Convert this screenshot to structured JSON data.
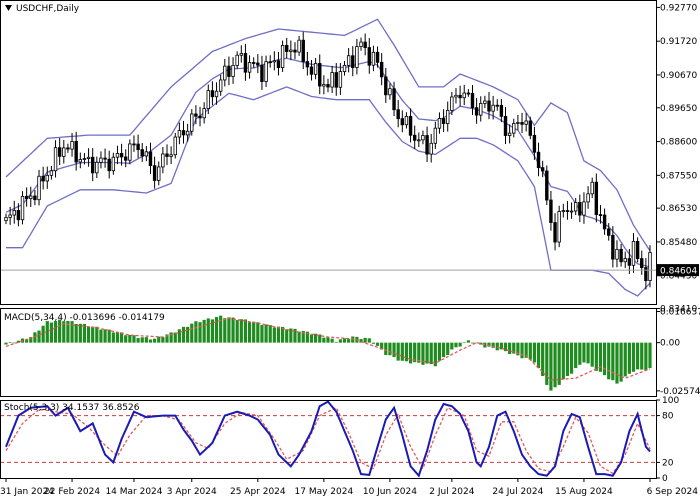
{
  "chart_data": {
    "type": "candlestick",
    "symbol_label": "USDCHF,Daily",
    "current_price_label": "0.84604",
    "colors": {
      "bollinger": "#6e6ec8",
      "candle": "#000000",
      "macd_hist": "#1f8c1f",
      "macd_signal": "#e05a5a",
      "stoch_main": "#1a1ab4",
      "stoch_signal": "#e05a5a",
      "level_line": "#c83c3c",
      "price_line": "#a0a0a0",
      "price_tag_bg": "#000000",
      "price_tag_fg": "#ffffff"
    },
    "main": {
      "ylim": [
        0.8355,
        0.93
      ],
      "y_ticks": [
        "0.92770",
        "0.91720",
        "0.90670",
        "0.89650",
        "0.88600",
        "0.87550",
        "0.86530",
        "0.85480",
        "0.84430",
        "0.83410"
      ],
      "y_tick_values": [
        0.9277,
        0.9172,
        0.9067,
        0.8965,
        0.886,
        0.8755,
        0.8653,
        0.8548,
        0.8443,
        0.8341
      ],
      "current_price": 0.84604,
      "close_anchors": [
        [
          0,
          0.861
        ],
        [
          8,
          0.872
        ],
        [
          14,
          0.885
        ],
        [
          20,
          0.879
        ],
        [
          26,
          0.88
        ],
        [
          32,
          0.885
        ],
        [
          36,
          0.876
        ],
        [
          42,
          0.888
        ],
        [
          47,
          0.895
        ],
        [
          52,
          0.905
        ],
        [
          56,
          0.912
        ],
        [
          62,
          0.908
        ],
        [
          66,
          0.912
        ],
        [
          70,
          0.916
        ],
        [
          74,
          0.908
        ],
        [
          78,
          0.903
        ],
        [
          82,
          0.909
        ],
        [
          86,
          0.916
        ],
        [
          90,
          0.91
        ],
        [
          94,
          0.896
        ],
        [
          98,
          0.889
        ],
        [
          102,
          0.884
        ],
        [
          106,
          0.894
        ],
        [
          110,
          0.902
        ],
        [
          114,
          0.896
        ],
        [
          118,
          0.898
        ],
        [
          122,
          0.888
        ],
        [
          125,
          0.894
        ],
        [
          129,
          0.88
        ],
        [
          131,
          0.868
        ],
        [
          133,
          0.856
        ],
        [
          135,
          0.866
        ],
        [
          138,
          0.864
        ],
        [
          142,
          0.871
        ],
        [
          145,
          0.858
        ],
        [
          147,
          0.853
        ],
        [
          149,
          0.848
        ],
        [
          152,
          0.852
        ],
        [
          155,
          0.845
        ],
        [
          156,
          0.848
        ]
      ],
      "bb_upper_anchors": [
        [
          0,
          0.875
        ],
        [
          10,
          0.887
        ],
        [
          20,
          0.888
        ],
        [
          30,
          0.888
        ],
        [
          40,
          0.903
        ],
        [
          50,
          0.914
        ],
        [
          58,
          0.918
        ],
        [
          66,
          0.921
        ],
        [
          74,
          0.92
        ],
        [
          82,
          0.919
        ],
        [
          90,
          0.924
        ],
        [
          94,
          0.916
        ],
        [
          100,
          0.903
        ],
        [
          106,
          0.903
        ],
        [
          110,
          0.907
        ],
        [
          118,
          0.903
        ],
        [
          124,
          0.899
        ],
        [
          128,
          0.891
        ],
        [
          132,
          0.898
        ],
        [
          136,
          0.895
        ],
        [
          140,
          0.88
        ],
        [
          144,
          0.877
        ],
        [
          148,
          0.871
        ],
        [
          152,
          0.86
        ],
        [
          156,
          0.852
        ]
      ],
      "bb_lower_anchors": [
        [
          0,
          0.853
        ],
        [
          4,
          0.853
        ],
        [
          10,
          0.866
        ],
        [
          18,
          0.871
        ],
        [
          26,
          0.871
        ],
        [
          34,
          0.87
        ],
        [
          40,
          0.873
        ],
        [
          46,
          0.893
        ],
        [
          54,
          0.901
        ],
        [
          60,
          0.899
        ],
        [
          68,
          0.903
        ],
        [
          74,
          0.9
        ],
        [
          80,
          0.899
        ],
        [
          88,
          0.899
        ],
        [
          92,
          0.892
        ],
        [
          96,
          0.886
        ],
        [
          100,
          0.883
        ],
        [
          104,
          0.882
        ],
        [
          110,
          0.887
        ],
        [
          114,
          0.887
        ],
        [
          118,
          0.885
        ],
        [
          124,
          0.88
        ],
        [
          128,
          0.872
        ],
        [
          132,
          0.846
        ],
        [
          136,
          0.846
        ],
        [
          142,
          0.846
        ],
        [
          146,
          0.845
        ],
        [
          150,
          0.84
        ],
        [
          153,
          0.838
        ],
        [
          156,
          0.842
        ]
      ]
    },
    "macd": {
      "label": "MACD(5,34,4) -0.013696 -0.014179",
      "ylim": [
        -0.0285,
        0.0185
      ],
      "y_ticks": [
        "0.016637",
        "0.00",
        "-0.025749"
      ],
      "y_tick_values": [
        0.016637,
        0.0,
        -0.025749
      ],
      "hist_anchors": [
        [
          0,
          -0.001
        ],
        [
          6,
          0.003
        ],
        [
          10,
          0.011
        ],
        [
          14,
          0.012
        ],
        [
          20,
          0.009
        ],
        [
          26,
          0.006
        ],
        [
          32,
          0.003
        ],
        [
          36,
          0.002
        ],
        [
          40,
          0.005
        ],
        [
          46,
          0.011
        ],
        [
          52,
          0.014
        ],
        [
          58,
          0.012
        ],
        [
          64,
          0.009
        ],
        [
          70,
          0.007
        ],
        [
          76,
          0.004
        ],
        [
          80,
          0.001
        ],
        [
          84,
          0.003
        ],
        [
          88,
          0.002
        ],
        [
          92,
          -0.006
        ],
        [
          96,
          -0.01
        ],
        [
          100,
          -0.011
        ],
        [
          104,
          -0.012
        ],
        [
          108,
          -0.004
        ],
        [
          112,
          0.001
        ],
        [
          116,
          -0.002
        ],
        [
          120,
          -0.004
        ],
        [
          124,
          -0.007
        ],
        [
          128,
          -0.01
        ],
        [
          132,
          -0.026
        ],
        [
          136,
          -0.018
        ],
        [
          140,
          -0.01
        ],
        [
          144,
          -0.016
        ],
        [
          148,
          -0.022
        ],
        [
          152,
          -0.015
        ],
        [
          156,
          -0.014
        ]
      ],
      "signal_anchors": [
        [
          0,
          -0.002
        ],
        [
          8,
          0.004
        ],
        [
          14,
          0.01
        ],
        [
          22,
          0.008
        ],
        [
          30,
          0.004
        ],
        [
          38,
          0.003
        ],
        [
          46,
          0.008
        ],
        [
          54,
          0.013
        ],
        [
          62,
          0.01
        ],
        [
          70,
          0.006
        ],
        [
          78,
          0.003
        ],
        [
          84,
          0.002
        ],
        [
          92,
          -0.004
        ],
        [
          98,
          -0.009
        ],
        [
          104,
          -0.011
        ],
        [
          110,
          -0.004
        ],
        [
          114,
          0.0
        ],
        [
          120,
          -0.003
        ],
        [
          126,
          -0.007
        ],
        [
          132,
          -0.02
        ],
        [
          138,
          -0.019
        ],
        [
          144,
          -0.013
        ],
        [
          150,
          -0.019
        ],
        [
          156,
          -0.014
        ]
      ]
    },
    "stoch": {
      "label": "Stoch(5,3,3) 34.1537 36.8526",
      "ylim": [
        0,
        100
      ],
      "levels": [
        80,
        20
      ],
      "y_ticks": [
        "100",
        "80",
        "20",
        "0"
      ],
      "y_tick_values": [
        100,
        80,
        20,
        0
      ],
      "main_anchors": [
        [
          0,
          40
        ],
        [
          3,
          80
        ],
        [
          6,
          90
        ],
        [
          10,
          92
        ],
        [
          12,
          80
        ],
        [
          15,
          90
        ],
        [
          18,
          60
        ],
        [
          21,
          70
        ],
        [
          24,
          30
        ],
        [
          26,
          20
        ],
        [
          28,
          50
        ],
        [
          31,
          85
        ],
        [
          34,
          78
        ],
        [
          38,
          80
        ],
        [
          41,
          80
        ],
        [
          43,
          62
        ],
        [
          45,
          48
        ],
        [
          47,
          30
        ],
        [
          50,
          45
        ],
        [
          53,
          80
        ],
        [
          56,
          85
        ],
        [
          59,
          80
        ],
        [
          61,
          75
        ],
        [
          64,
          55
        ],
        [
          66,
          30
        ],
        [
          69,
          15
        ],
        [
          71,
          30
        ],
        [
          74,
          60
        ],
        [
          76,
          92
        ],
        [
          78,
          98
        ],
        [
          80,
          85
        ],
        [
          82,
          60
        ],
        [
          84,
          35
        ],
        [
          86,
          5
        ],
        [
          88,
          4
        ],
        [
          90,
          40
        ],
        [
          92,
          75
        ],
        [
          94,
          90
        ],
        [
          96,
          55
        ],
        [
          98,
          15
        ],
        [
          100,
          3
        ],
        [
          102,
          35
        ],
        [
          104,
          75
        ],
        [
          106,
          95
        ],
        [
          108,
          92
        ],
        [
          110,
          82
        ],
        [
          112,
          60
        ],
        [
          114,
          20
        ],
        [
          115,
          15
        ],
        [
          117,
          40
        ],
        [
          119,
          80
        ],
        [
          121,
          85
        ],
        [
          123,
          60
        ],
        [
          125,
          30
        ],
        [
          127,
          15
        ],
        [
          129,
          5
        ],
        [
          131,
          3
        ],
        [
          133,
          15
        ],
        [
          135,
          60
        ],
        [
          137,
          82
        ],
        [
          139,
          78
        ],
        [
          141,
          40
        ],
        [
          143,
          5
        ],
        [
          145,
          5
        ],
        [
          147,
          3
        ],
        [
          149,
          20
        ],
        [
          151,
          60
        ],
        [
          153,
          82
        ],
        [
          155,
          40
        ],
        [
          156,
          34
        ]
      ],
      "signal_anchors": [
        [
          0,
          35
        ],
        [
          4,
          70
        ],
        [
          8,
          88
        ],
        [
          12,
          85
        ],
        [
          16,
          82
        ],
        [
          20,
          65
        ],
        [
          24,
          42
        ],
        [
          27,
          28
        ],
        [
          30,
          55
        ],
        [
          34,
          80
        ],
        [
          38,
          80
        ],
        [
          42,
          74
        ],
        [
          46,
          45
        ],
        [
          49,
          38
        ],
        [
          53,
          70
        ],
        [
          57,
          84
        ],
        [
          61,
          80
        ],
        [
          65,
          50
        ],
        [
          68,
          24
        ],
        [
          72,
          35
        ],
        [
          76,
          80
        ],
        [
          80,
          90
        ],
        [
          83,
          58
        ],
        [
          86,
          20
        ],
        [
          89,
          12
        ],
        [
          92,
          55
        ],
        [
          95,
          82
        ],
        [
          98,
          40
        ],
        [
          101,
          12
        ],
        [
          104,
          55
        ],
        [
          107,
          90
        ],
        [
          111,
          80
        ],
        [
          114,
          35
        ],
        [
          117,
          28
        ],
        [
          120,
          72
        ],
        [
          123,
          72
        ],
        [
          126,
          35
        ],
        [
          129,
          12
        ],
        [
          132,
          8
        ],
        [
          135,
          40
        ],
        [
          138,
          78
        ],
        [
          141,
          58
        ],
        [
          144,
          15
        ],
        [
          147,
          6
        ],
        [
          150,
          30
        ],
        [
          153,
          70
        ],
        [
          156,
          37
        ]
      ]
    },
    "x_labels": [
      "31 Jan 2024",
      "22 Feb 2024",
      "14 Mar 2024",
      "3 Apr 2024",
      "25 Apr 2024",
      "17 May 2024",
      "10 Jun 2024",
      "2 Jul 2024",
      "24 Jul 2024",
      "15 Aug 2024",
      "6 Sep 2024"
    ],
    "x_label_index": [
      0,
      16,
      31,
      45,
      61,
      77,
      93,
      108,
      124,
      140,
      156
    ],
    "bar_count": 157
  }
}
